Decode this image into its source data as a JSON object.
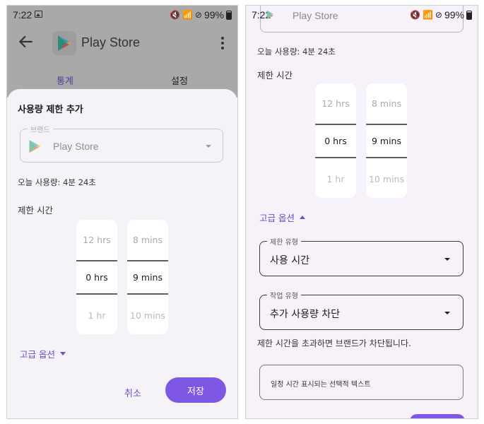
{
  "status_bar": {
    "time": "7:22",
    "battery": "99%"
  },
  "app": {
    "title": "Play Store",
    "tabs": [
      "통계",
      "설정"
    ]
  },
  "dialog": {
    "title": "사용량 제한 추가",
    "brand_label": "브랜드",
    "brand_value": "Play Store",
    "usage_today": "오늘 사용량: 4분 24초",
    "limit_time_label": "제한 시간",
    "hours_picker": {
      "prev": "12 hrs",
      "current": "0 hrs",
      "next": "1 hr"
    },
    "minutes_picker": {
      "prev": "8 mins",
      "current": "9 mins",
      "next": "10 mins"
    },
    "advanced_options": "고급 옵션",
    "cancel": "취소",
    "save": "저장"
  },
  "advanced": {
    "limit_type_label": "제한 유형",
    "limit_type_value": "사용 시간",
    "action_type_label": "작업 유형",
    "action_type_value": "추가 사용량 차단",
    "note": "제한 시간을 초과하면 브랜드가 차단됩니다.",
    "optional_text": "일정 시간 표시되는 선택적 텍스트"
  },
  "colors": {
    "accent": "#7e57e4",
    "tab_active": "#4b3d94",
    "scrim": "#a9a9a9"
  }
}
